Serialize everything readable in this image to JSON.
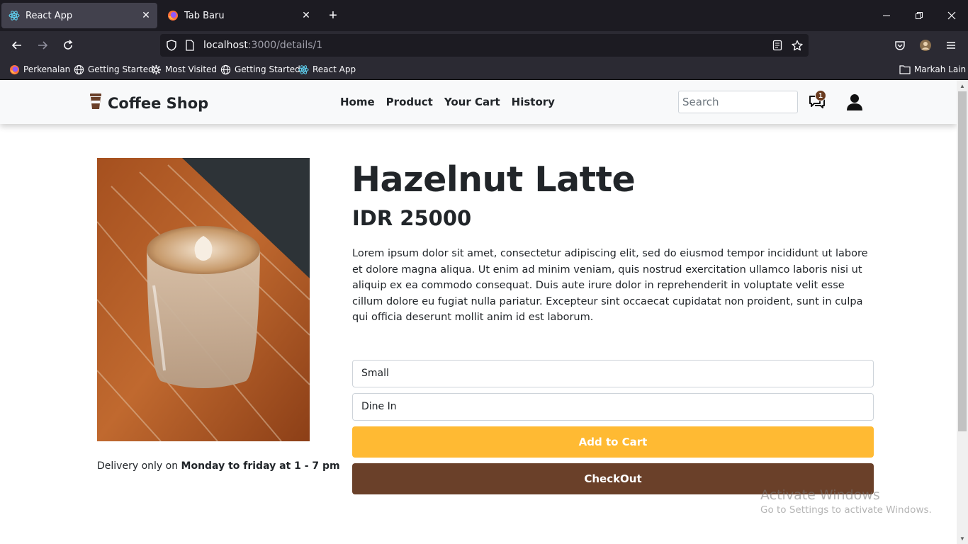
{
  "browser": {
    "tabs": [
      {
        "title": "React App",
        "active": true,
        "icon": "react-icon"
      },
      {
        "title": "Tab Baru",
        "active": false,
        "icon": "firefox-icon"
      }
    ],
    "url": {
      "host": "localhost",
      "rest": ":3000/details/1"
    },
    "bookmarks": [
      {
        "label": "Perkenalan",
        "icon": "firefox-icon"
      },
      {
        "label": "Getting Started",
        "icon": "globe-icon"
      },
      {
        "label": "Most Visited",
        "icon": "gear-icon"
      },
      {
        "label": "Getting Started",
        "icon": "globe-icon"
      },
      {
        "label": "React App",
        "icon": "react-icon"
      }
    ],
    "other_bookmarks": "Markah Lain"
  },
  "header": {
    "brand": "Coffee Shop",
    "menu": [
      "Home",
      "Product",
      "Your Cart",
      "History"
    ],
    "search_placeholder": "Search",
    "chat_badge": "1"
  },
  "product": {
    "name": "Hazelnut Latte",
    "price": "IDR 25000",
    "description": "Lorem ipsum dolor sit amet, consectetur adipiscing elit, sed do eiusmod tempor incididunt ut labore et dolore magna aliqua. Ut enim ad minim veniam, quis nostrud exercitation ullamco laboris nisi ut aliquip ex ea commodo consequat. Duis aute irure dolor in reprehenderit in voluptate velit esse cillum dolore eu fugiat nulla pariatur. Excepteur sint occaecat cupidatat non proident, sunt in culpa qui officia deserunt mollit anim id est laborum.",
    "delivery_prefix": "Delivery only on ",
    "delivery_bold": "Monday to friday at 1 - 7 pm",
    "size_value": "Small",
    "delivery_method_value": "Dine In",
    "add_to_cart": "Add to Cart",
    "checkout": "CheckOut"
  },
  "watermark": {
    "line1": "Activate Windows",
    "line2": "Go to Settings to activate Windows."
  },
  "colors": {
    "accent_yellow": "#ffba33",
    "brown": "#6a4029"
  }
}
